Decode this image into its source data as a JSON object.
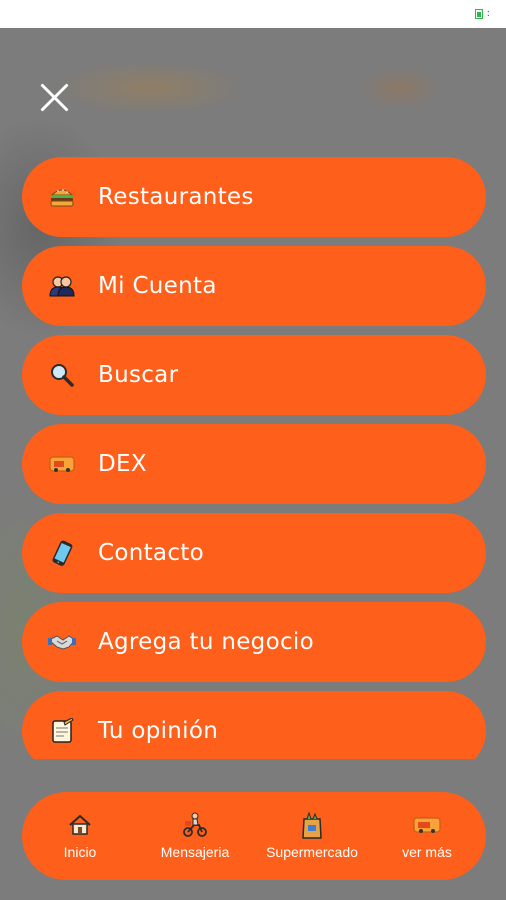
{
  "menu": {
    "items": [
      {
        "label": "Restaurantes",
        "icon": "burger-icon"
      },
      {
        "label": "Mi Cuenta",
        "icon": "user-account-icon"
      },
      {
        "label": "Buscar",
        "icon": "magnifier-icon"
      },
      {
        "label": "DEX",
        "icon": "delivery-truck-icon"
      },
      {
        "label": "Contacto",
        "icon": "phone-icon"
      },
      {
        "label": "Agrega tu negocio",
        "icon": "handshake-icon"
      },
      {
        "label": "Tu opinión",
        "icon": "notepad-icon"
      }
    ]
  },
  "bottom_nav": {
    "items": [
      {
        "label": "Inicio",
        "icon": "home-icon"
      },
      {
        "label": "Mensajeria",
        "icon": "delivery-scooter-icon"
      },
      {
        "label": "Supermercado",
        "icon": "grocery-bag-icon"
      },
      {
        "label": "ver más",
        "icon": "delivery-truck-icon"
      }
    ]
  },
  "colors": {
    "accent": "#fe5f1a",
    "overlay": "#7c7c7c",
    "text": "#ffffff"
  }
}
